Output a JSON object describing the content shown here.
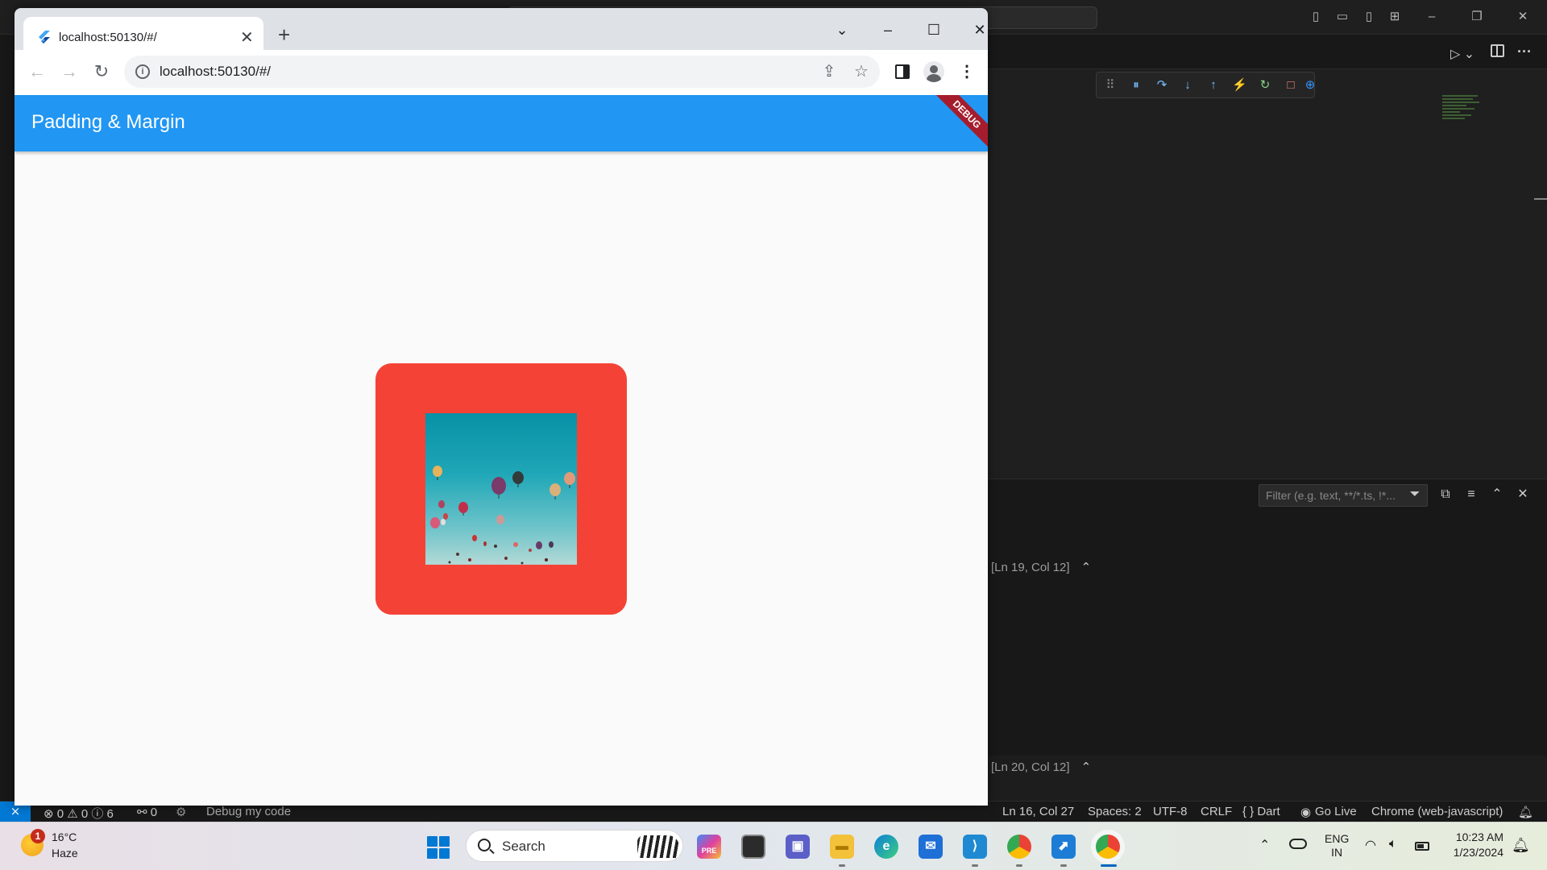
{
  "browser": {
    "tab_title": "localhost:50130/#/",
    "url": "localhost:50130/#/",
    "new_tab_label": "+",
    "window_controls": [
      "minimize-icon",
      "maximize-icon",
      "close-icon"
    ]
  },
  "app": {
    "title": "Padding & Margin",
    "debug_banner": "DEBUG",
    "app_bar_color": "#2196f3",
    "container_color": "#f44336",
    "image_subject": "hot air balloons"
  },
  "vscode": {
    "filter_placeholder": "Filter (e.g. text, **/*.ts, !*...",
    "panel_lines": [
      "[Ln 19, Col 12]",
      "[Ln 20, Col 12]"
    ],
    "statusbar": {
      "problems": "⊗ 0 ⚠ 0 ⓘ 6",
      "ports": "⚯ 0",
      "debug_target": "Debug my code",
      "cursor": "Ln 16, Col 27",
      "spaces": "Spaces: 2",
      "encoding": "UTF-8",
      "eol": "CRLF",
      "language": "{ } Dart",
      "go_live": "Go Live",
      "debugger": "Chrome (web-javascript)"
    }
  },
  "taskbar": {
    "weather_temp": "16°C",
    "weather_condition": "Haze",
    "weather_badge": "1",
    "search_label": "Search",
    "lang_line1": "ENG",
    "lang_line2": "IN",
    "time": "10:23 AM",
    "date": "1/23/2024"
  }
}
